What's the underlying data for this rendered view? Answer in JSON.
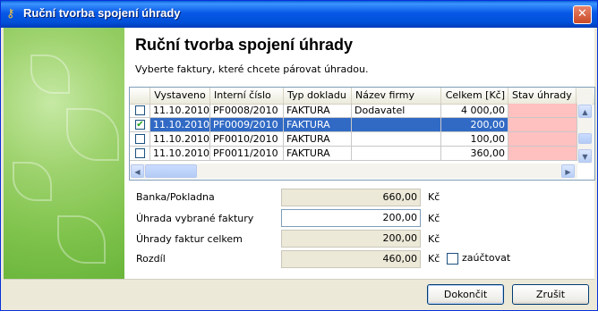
{
  "window": {
    "title": "Ruční tvorba spojení úhrady",
    "close_glyph": "✕"
  },
  "main": {
    "heading": "Ruční tvorba spojení úhrady",
    "subtitle": "Vyberte faktury, které chcete párovat úhradou."
  },
  "grid": {
    "columns": [
      "Vystaveno",
      "Interní číslo",
      "Typ dokladu",
      "Název firmy",
      "Celkem [Kč]",
      "Stav úhrady"
    ],
    "rows": [
      {
        "checked": false,
        "date": "11.10.2010",
        "number": "PF0008/2010",
        "type": "FAKTURA",
        "company": "Dodavatel",
        "total": "4 000,00",
        "status": ""
      },
      {
        "checked": true,
        "date": "11.10.2010",
        "number": "PF0009/2010",
        "type": "FAKTURA",
        "company": "",
        "total": "200,00",
        "status": ""
      },
      {
        "checked": false,
        "date": "11.10.2010",
        "number": "PF0010/2010",
        "type": "FAKTURA",
        "company": "",
        "total": "100,00",
        "status": ""
      },
      {
        "checked": false,
        "date": "11.10.2010",
        "number": "PF0011/2010",
        "type": "FAKTURA",
        "company": "",
        "total": "360,00",
        "status": ""
      }
    ],
    "selected_row": 1
  },
  "summary": {
    "bank": {
      "label": "Banka/Pokladna",
      "value": "660,00",
      "unit": "Kč"
    },
    "selected_payment": {
      "label": "Úhrada vybrané faktury",
      "value": "200,00",
      "unit": "Kč"
    },
    "total_payments": {
      "label": "Úhrady faktur celkem",
      "value": "200,00",
      "unit": "Kč"
    },
    "difference": {
      "label": "Rozdíl",
      "value": "460,00",
      "unit": "Kč"
    },
    "post_checkbox": {
      "label": "zaúčtovat",
      "checked": false
    }
  },
  "buttons": {
    "finish": "Dokončit",
    "cancel": "Zrušit"
  },
  "colors": {
    "selection": "#316ac5",
    "status_unpaid": "#ffc0c0",
    "titlebar": "#0054e3"
  }
}
